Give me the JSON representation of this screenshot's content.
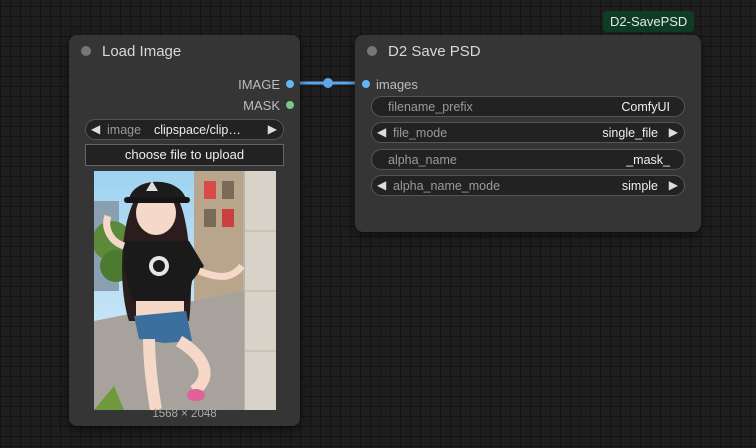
{
  "load_node": {
    "title": "Load Image",
    "outputs": [
      {
        "label": "IMAGE",
        "color": "#64b5f6"
      },
      {
        "label": "MASK",
        "color": "#81c784"
      }
    ],
    "image_widget": {
      "label": "image",
      "value": "clipspace/clip…"
    },
    "upload_button": "choose file to upload",
    "dimensions": "1568 × 2048"
  },
  "save_node": {
    "badge": "D2-SavePSD",
    "title": "D2 Save PSD",
    "input": {
      "label": "images",
      "color": "#64b5f6"
    },
    "widgets": [
      {
        "label": "filename_prefix",
        "value": "ComfyUI",
        "has_arrows": false
      },
      {
        "label": "file_mode",
        "value": "single_file",
        "has_arrows": true
      },
      {
        "label": "alpha_name",
        "value": "_mask_",
        "has_arrows": false
      },
      {
        "label": "alpha_name_mode",
        "value": "simple",
        "has_arrows": true
      }
    ]
  },
  "link_color": "#64b5f6"
}
